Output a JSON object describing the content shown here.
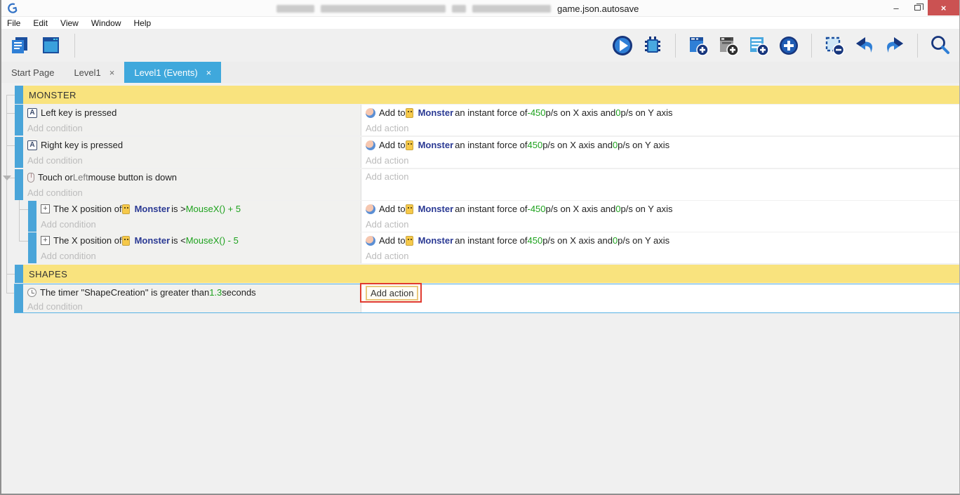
{
  "window": {
    "title_visible": "game.json.autosave",
    "controls": {
      "minimize": "–",
      "close": "×"
    }
  },
  "menu": {
    "items": [
      "File",
      "Edit",
      "View",
      "Window",
      "Help"
    ]
  },
  "toolbar": {
    "left_icons": [
      "project-manager",
      "scene-editor"
    ],
    "right_icons": [
      "preview-play",
      "debugger",
      "add-event",
      "add-subevent",
      "add-comment",
      "add-other-event",
      "delete-selection",
      "undo",
      "redo",
      "search"
    ]
  },
  "tabs": {
    "close_glyph": "×",
    "items": [
      {
        "label": "Start Page",
        "active": false,
        "closable": false
      },
      {
        "label": "Level1",
        "active": false,
        "closable": true
      },
      {
        "label": "Level1 (Events)",
        "active": true,
        "closable": true
      }
    ]
  },
  "events": {
    "add_condition_label": "Add condition",
    "add_action_label": "Add action",
    "rows": [
      {
        "kind": "group",
        "label": "MONSTER"
      },
      {
        "kind": "event",
        "depth": 0,
        "condition": {
          "icon": "keyboard",
          "segments": [
            {
              "text": "Left key is pressed"
            }
          ]
        },
        "actions": [
          {
            "icon": "force",
            "segments": [
              {
                "text": "Add to "
              },
              {
                "icon": "object"
              },
              {
                "text": "Monster",
                "style": "object"
              },
              {
                "text": " an instant force of "
              },
              {
                "text": "-450",
                "style": "value"
              },
              {
                "text": " p/s on X axis and "
              },
              {
                "text": "0",
                "style": "value"
              },
              {
                "text": " p/s on Y axis"
              }
            ]
          }
        ]
      },
      {
        "kind": "event",
        "depth": 0,
        "condition": {
          "icon": "keyboard",
          "segments": [
            {
              "text": "Right key is pressed"
            }
          ]
        },
        "actions": [
          {
            "icon": "force",
            "segments": [
              {
                "text": "Add to "
              },
              {
                "icon": "object"
              },
              {
                "text": "Monster",
                "style": "object"
              },
              {
                "text": " an instant force of "
              },
              {
                "text": "450",
                "style": "value"
              },
              {
                "text": " p/s on X axis and "
              },
              {
                "text": "0",
                "style": "value"
              },
              {
                "text": " p/s on Y axis"
              }
            ]
          }
        ]
      },
      {
        "kind": "event",
        "depth": 0,
        "tight": true,
        "collapse_marker": true,
        "empty_action": true,
        "condition": {
          "icon": "mouse",
          "segments": [
            {
              "text": "Touch or "
            },
            {
              "text": "Left",
              "style": "param"
            },
            {
              "text": " mouse button is down"
            }
          ]
        },
        "actions": []
      },
      {
        "kind": "event",
        "depth": 1,
        "tight": true,
        "condition": {
          "icon": "position",
          "segments": [
            {
              "text": "The X position of "
            },
            {
              "icon": "object"
            },
            {
              "text": "Monster",
              "style": "object"
            },
            {
              "text": " is > "
            },
            {
              "text": "MouseX() + 5",
              "style": "value"
            }
          ]
        },
        "actions": [
          {
            "icon": "force",
            "segments": [
              {
                "text": "Add to "
              },
              {
                "icon": "object"
              },
              {
                "text": "Monster",
                "style": "object"
              },
              {
                "text": " an instant force of "
              },
              {
                "text": "-450",
                "style": "value"
              },
              {
                "text": " p/s on X axis and "
              },
              {
                "text": "0",
                "style": "value"
              },
              {
                "text": " p/s on Y axis"
              }
            ]
          }
        ]
      },
      {
        "kind": "event",
        "depth": 1,
        "condition": {
          "icon": "position",
          "segments": [
            {
              "text": "The X position of "
            },
            {
              "icon": "object"
            },
            {
              "text": "Monster",
              "style": "object"
            },
            {
              "text": " is < "
            },
            {
              "text": "MouseX() - 5",
              "style": "value"
            }
          ]
        },
        "actions": [
          {
            "icon": "force",
            "segments": [
              {
                "text": "Add to "
              },
              {
                "icon": "object"
              },
              {
                "text": "Monster",
                "style": "object"
              },
              {
                "text": " an instant force of "
              },
              {
                "text": "450",
                "style": "value"
              },
              {
                "text": " p/s on X axis and "
              },
              {
                "text": "0",
                "style": "value"
              },
              {
                "text": " p/s on Y axis"
              }
            ]
          }
        ]
      },
      {
        "kind": "group",
        "label": "SHAPES",
        "last": true
      },
      {
        "kind": "event",
        "depth": 0,
        "selected": true,
        "condition": {
          "icon": "timer",
          "segments": [
            {
              "text": "The timer \"ShapeCreation\" is greater than "
            },
            {
              "text": "1.3",
              "style": "value"
            },
            {
              "text": " seconds"
            }
          ]
        },
        "action_button": {
          "label": "Add action",
          "highlighted": true,
          "highlight_color": "#e03a2f"
        }
      }
    ]
  }
}
